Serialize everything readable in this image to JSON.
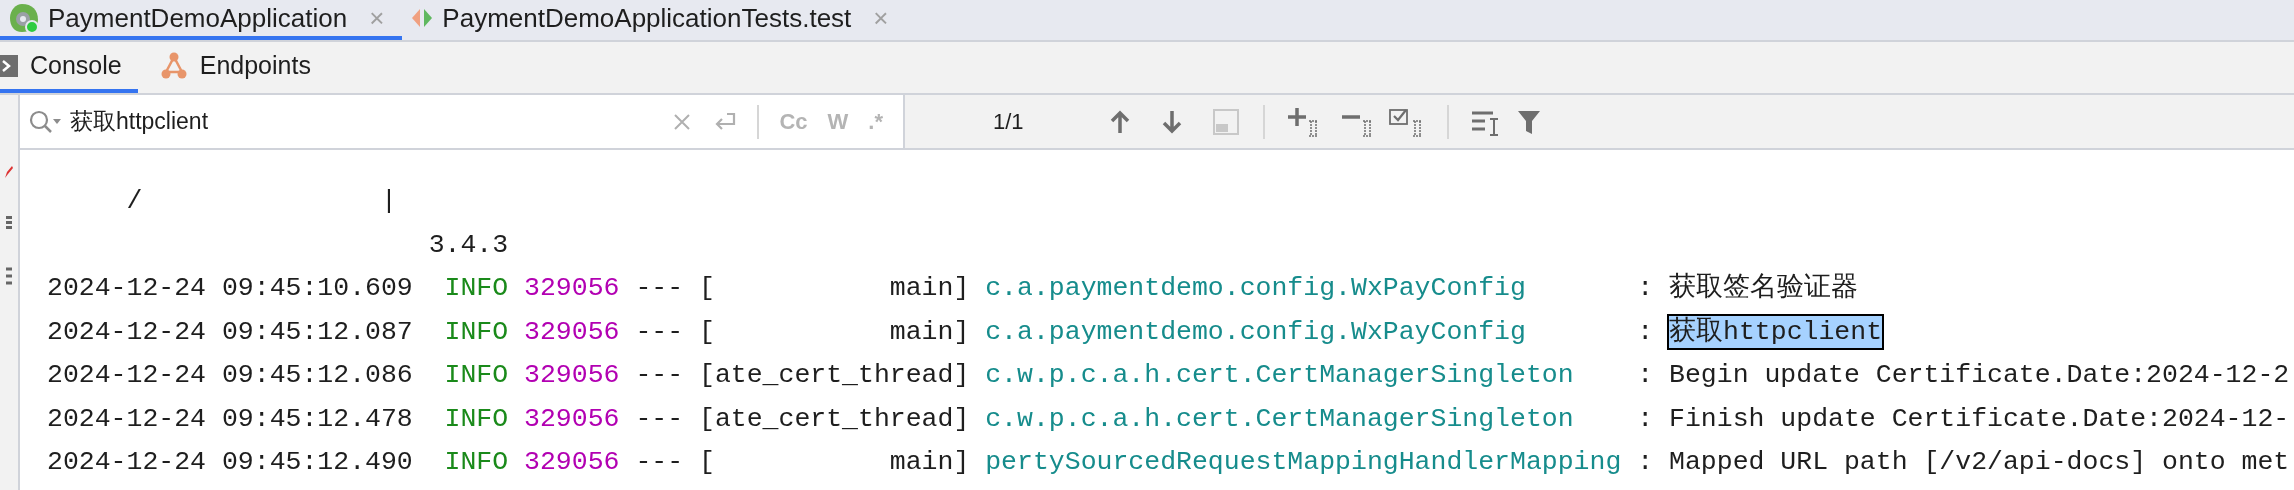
{
  "editor_tabs": [
    {
      "label": "PaymentDemoApplication",
      "selected": true,
      "close": "×"
    },
    {
      "label": "PaymentDemoApplicationTests.test",
      "selected": false,
      "close": "×"
    }
  ],
  "tool_tabs": [
    {
      "label": "Console",
      "selected": true
    },
    {
      "label": "Endpoints",
      "selected": false
    }
  ],
  "search": {
    "value": "获取httpclient",
    "options": [
      "Cc",
      "W",
      ".*"
    ],
    "match_count": "1/1"
  },
  "console": {
    "banner": [
      "     /               |",
      "                        3.4.3"
    ],
    "rows": [
      {
        "timestamp": "2024-12-24 09:45:10.609",
        "level": "INFO",
        "pid": "329056",
        "separator": "---",
        "thread": "[           main]",
        "logger": "c.a.paymentdemo.config.WxPayConfig",
        "colon": ":",
        "message": "获取签名验证器",
        "match": false
      },
      {
        "timestamp": "2024-12-24 09:45:12.087",
        "level": "INFO",
        "pid": "329056",
        "separator": "---",
        "thread": "[           main]",
        "logger": "c.a.paymentdemo.config.WxPayConfig",
        "colon": ":",
        "message": "获取httpclient",
        "match": true
      },
      {
        "timestamp": "2024-12-24 09:45:12.086",
        "level": "INFO",
        "pid": "329056",
        "separator": "---",
        "thread": "[ate_cert_thread]",
        "logger": "c.w.p.c.a.h.cert.CertManagerSingleton",
        "colon": ":",
        "message": "Begin update Certificate.Date:2024-12-2",
        "match": false
      },
      {
        "timestamp": "2024-12-24 09:45:12.478",
        "level": "INFO",
        "pid": "329056",
        "separator": "---",
        "thread": "[ate_cert_thread]",
        "logger": "c.w.p.c.a.h.cert.CertManagerSingleton",
        "colon": ":",
        "message": "Finish update Certificate.Date:2024-12-",
        "match": false
      },
      {
        "timestamp": "2024-12-24 09:45:12.490",
        "level": "INFO",
        "pid": "329056",
        "separator": "---",
        "thread": "[           main]",
        "logger": "pertySourcedRequestMappingHandlerMapping",
        "colon": ":",
        "message": "Mapped URL path [/v2/api-docs] onto met",
        "match": false
      }
    ]
  }
}
